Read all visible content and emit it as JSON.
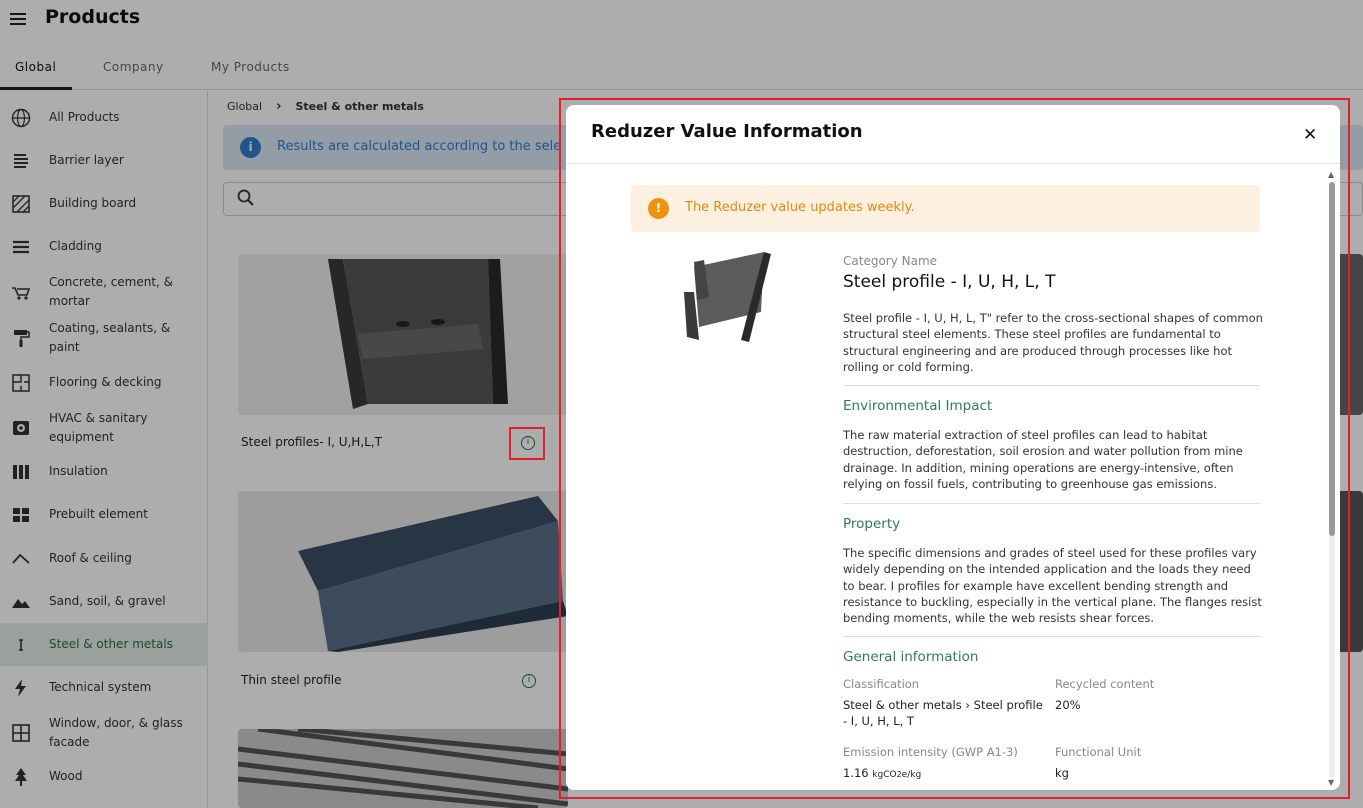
{
  "header": {
    "title": "Products"
  },
  "tabs": [
    {
      "label": "Global"
    },
    {
      "label": "Company"
    },
    {
      "label": "My Products"
    }
  ],
  "sidebar": {
    "items": [
      {
        "label": "All Products",
        "icon": "globe-icon"
      },
      {
        "label": "Barrier layer",
        "icon": "layers-icon"
      },
      {
        "label": "Building board",
        "icon": "hatched-square-icon"
      },
      {
        "label": "Cladding",
        "icon": "lines-icon"
      },
      {
        "label": "Concrete, cement, & mortar",
        "icon": "wheelbarrow-icon"
      },
      {
        "label": "Coating, sealants, & paint",
        "icon": "paint-roller-icon"
      },
      {
        "label": "Flooring & decking",
        "icon": "floorplan-icon"
      },
      {
        "label": "HVAC & sanitary equipment",
        "icon": "hvac-icon"
      },
      {
        "label": "Insulation",
        "icon": "insulation-icon"
      },
      {
        "label": "Prebuilt element",
        "icon": "blocks-icon"
      },
      {
        "label": "Roof & ceiling",
        "icon": "roof-icon"
      },
      {
        "label": "Sand, soil, & gravel",
        "icon": "mountain-icon"
      },
      {
        "label": "Steel & other metals",
        "icon": "beam-icon"
      },
      {
        "label": "Technical system",
        "icon": "lightning-icon"
      },
      {
        "label": "Window, door, & glass facade",
        "icon": "window-icon"
      },
      {
        "label": "Wood",
        "icon": "tree-icon"
      }
    ],
    "selected": "Steel & other metals"
  },
  "breadcrumb": {
    "root": "Global",
    "current": "Steel & other metals"
  },
  "info_banner": {
    "text": "Results are calculated according to the sele"
  },
  "cards": [
    {
      "label": "Steel profiles- I, U,H,L,T"
    },
    {
      "label": "Thin steel profile"
    }
  ],
  "modal": {
    "title": "Reduzer Value Information",
    "notice": "The Reduzer value updates weekly.",
    "category_label": "Category Name",
    "category_name": "Steel profile - I, U, H, L, T",
    "description": "Steel profile - I, U, H, L, T\" refer to the cross-sectional shapes of common structural steel elements. These steel profiles are fundamental to structural engineering and are produced through processes like hot rolling or cold forming.",
    "env_title": "Environmental Impact",
    "env_text": "The raw material extraction of steel profiles can lead to habitat destruction, deforestation, soil erosion and water pollution from mine drainage. In addition, mining operations are energy-intensive, often relying on fossil fuels, contributing to greenhouse gas emissions.",
    "prop_title": "Property",
    "prop_text": "The specific dimensions and grades of steel used for these profiles vary widely depending on the intended application and the loads they need to bear. I profiles for example have excellent bending strength and resistance to buckling, especially in the vertical plane. The flanges resist bending moments, while the web resists shear forces.",
    "gen_title": "General information",
    "classification_label": "Classification",
    "classification_value": "Steel & other metals › Steel profile - I, U, H, L, T",
    "recycled_label": "Recycled content",
    "recycled_value": "20%",
    "emission_label": "Emission intensity (GWP A1-3)",
    "emission_number": "1.16",
    "emission_unit_kg": "kgCO",
    "emission_unit_sub": "2",
    "emission_unit_rest": "e/kg",
    "unit_label": "Functional Unit",
    "unit_value": "kg"
  }
}
